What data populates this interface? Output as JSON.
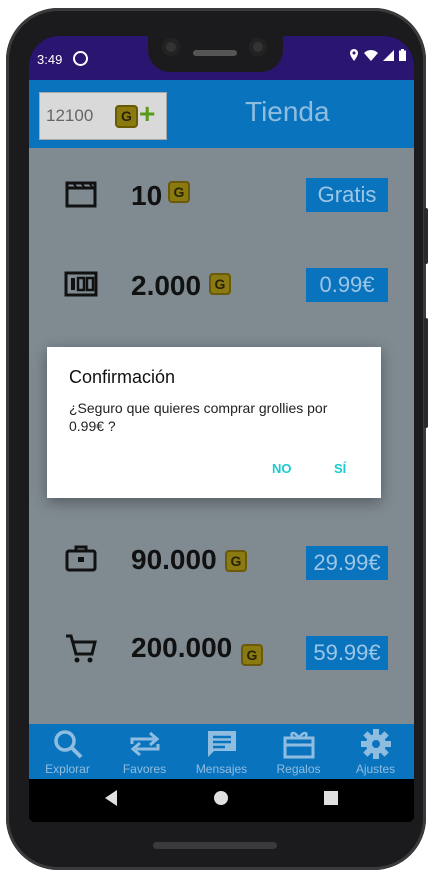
{
  "status_bar": {
    "time": "3:49",
    "icons": [
      "location-icon",
      "wifi-icon",
      "signal-icon",
      "battery-icon"
    ]
  },
  "header": {
    "coins": "12100",
    "coin_symbol": "G",
    "add_symbol": "+",
    "title": "Tienda"
  },
  "packages": [
    {
      "icon": "clapperboard-icon",
      "amount": "10",
      "price": "Gratis"
    },
    {
      "icon": "hundred-icon",
      "amount": "2.000",
      "price": "0.99€"
    },
    {
      "icon": "briefcase-icon",
      "amount": "90.000",
      "price": "29.99€"
    },
    {
      "icon": "cart-icon",
      "amount": "200.000",
      "price": "59.99€"
    }
  ],
  "nav": [
    {
      "icon": "search-icon",
      "label": "Explorar"
    },
    {
      "icon": "swap-icon",
      "label": "Favores"
    },
    {
      "icon": "message-icon",
      "label": "Mensajes"
    },
    {
      "icon": "gift-icon",
      "label": "Regalos"
    },
    {
      "icon": "gear-icon",
      "label": "Ajustes"
    }
  ],
  "dialog": {
    "title": "Confirmación",
    "message": "¿Seguro que quieres comprar grollies por 0.99€ ?",
    "no_label": "NO",
    "yes_label": "SÍ"
  },
  "colors": {
    "accent": "#0a73be",
    "status_bar": "#2a1670",
    "dialog_button": "#1ccad0",
    "overlay": "#7f8a91"
  }
}
